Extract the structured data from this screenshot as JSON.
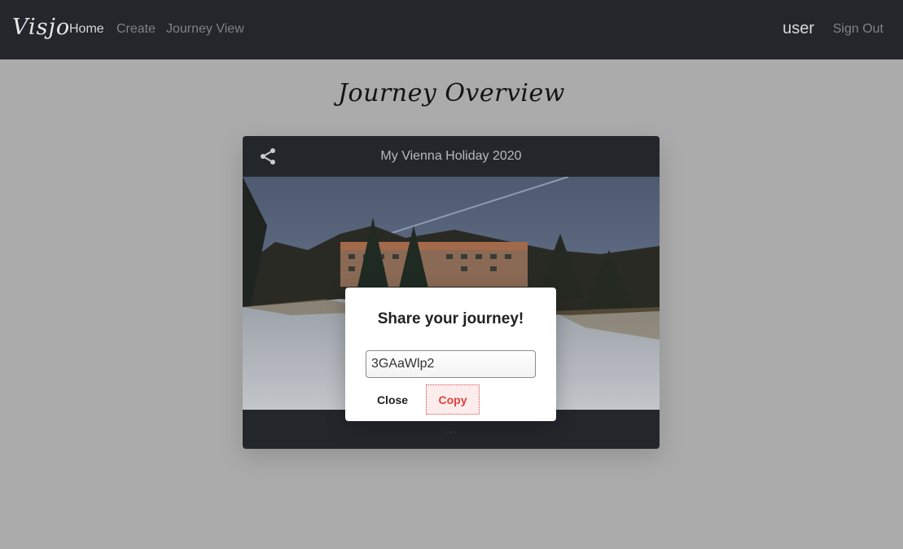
{
  "navbar": {
    "brand": "Visjo",
    "links": [
      "Home",
      "Create",
      "Journey View"
    ],
    "user": "user",
    "sign_out": "Sign Out"
  },
  "page": {
    "title": "Journey Overview"
  },
  "journey_card": {
    "title": "My Vienna Holiday 2020",
    "share_icon": "share-icon",
    "image_alt": "winter landscape with a large building among trees",
    "dots": "···"
  },
  "share_modal": {
    "title": "Share your journey!",
    "code": "3GAaWlp2",
    "close_label": "Close",
    "copy_label": "Copy"
  },
  "colors": {
    "navbar_bg": "#23272c",
    "page_bg": "#ababab",
    "accent": "#e0413d"
  }
}
